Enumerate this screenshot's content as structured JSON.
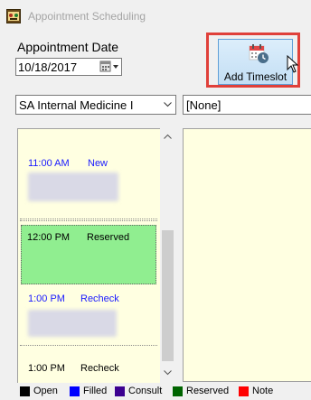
{
  "window": {
    "title": "Appointment Scheduling"
  },
  "date": {
    "label": "Appointment Date",
    "value": "10/18/2017"
  },
  "toolbar": {
    "add_timeslot_label": "Add Timeslot"
  },
  "dropdowns": {
    "provider": "SA Internal Medicine I",
    "secondary": "[None]"
  },
  "slots": [
    {
      "time": "11:00 AM",
      "status": "New",
      "color": "#1a1aff"
    },
    {
      "time": "12:00 PM",
      "status": "Reserved",
      "color": "#000000",
      "background": "#90ee90"
    },
    {
      "time": "1:00 PM",
      "status": "Recheck",
      "color": "#1a1aff"
    },
    {
      "time": "1:00 PM",
      "status": "Recheck",
      "color": "#000000"
    }
  ],
  "legend": [
    {
      "label": "Open",
      "color": "#000000"
    },
    {
      "label": "Filled",
      "color": "#0000ff"
    },
    {
      "label": "Consult",
      "color": "#3c0090"
    },
    {
      "label": "Reserved",
      "color": "#006400"
    },
    {
      "label": "Note",
      "color": "#ff0000"
    }
  ]
}
